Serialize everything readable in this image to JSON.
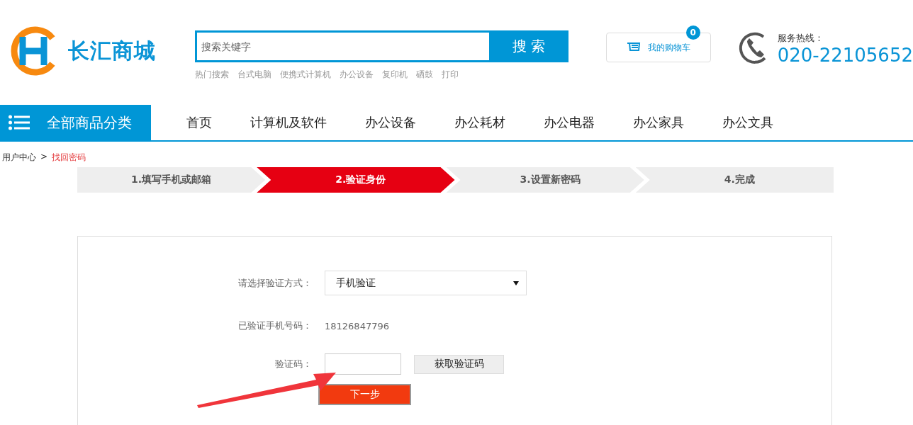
{
  "logo": {
    "text": "长汇商城"
  },
  "search": {
    "placeholder": "搜索关键字",
    "button": "搜 索",
    "hot_label": "热门搜索",
    "hot_items": [
      "台式电脑",
      "便携式计算机",
      "办公设备",
      "复印机",
      "硒鼓",
      "打印"
    ]
  },
  "cart": {
    "label": "我的购物车",
    "count": "0"
  },
  "hotline": {
    "label": "服务热线：",
    "number": "020-22105652"
  },
  "nav": {
    "category": "全部商品分类",
    "items": [
      "首页",
      "计算机及软件",
      "办公设备",
      "办公耗材",
      "办公电器",
      "办公家具",
      "办公文具"
    ]
  },
  "breadcrumb": {
    "separator": ">",
    "items": [
      {
        "label": "用户中心",
        "current": false
      },
      {
        "label": "找回密码",
        "current": true
      }
    ]
  },
  "steps": [
    {
      "label": "1.填写手机或邮箱",
      "selected": false
    },
    {
      "label": "2.验证身份",
      "selected": true
    },
    {
      "label": "3.设置新密码",
      "selected": false
    },
    {
      "label": "4.完成",
      "selected": false
    }
  ],
  "form": {
    "rows": [
      {
        "kind": "select",
        "label": "请选择验证方式：",
        "value": "手机验证"
      },
      {
        "kind": "text",
        "label": "已验证手机号码：",
        "value": "18126847796"
      },
      {
        "kind": "code",
        "label": "验证码：",
        "button": "获取验证码"
      }
    ],
    "submit": "下一步"
  }
}
